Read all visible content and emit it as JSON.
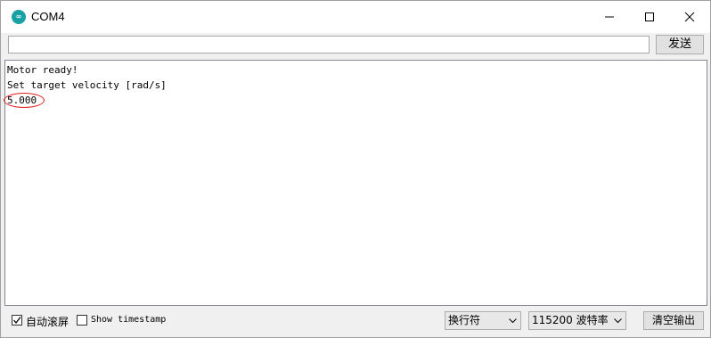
{
  "window": {
    "title": "COM4",
    "icon": "arduino-infinity-icon",
    "accent_color": "#17a1a5"
  },
  "send": {
    "input_value": "",
    "button_label": "发送"
  },
  "output": {
    "lines": [
      "Motor ready!",
      "Set target velocity [rad/s]",
      "5.000"
    ],
    "highlight_color": "#e02020"
  },
  "bottom": {
    "autoscroll_label": "自动滚屏",
    "autoscroll_checked": true,
    "timestamp_label": "Show timestamp",
    "timestamp_checked": false,
    "line_ending": "换行符",
    "baud_rate": "115200 波特率",
    "clear_label": "清空输出"
  }
}
